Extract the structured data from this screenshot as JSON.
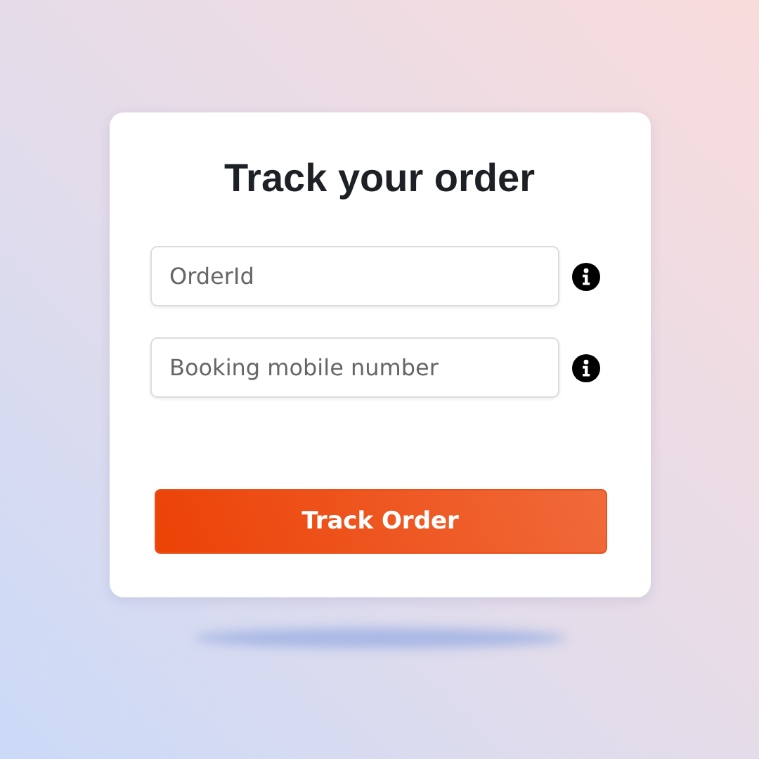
{
  "title": "Track your order",
  "fields": [
    {
      "placeholder": "OrderId"
    },
    {
      "placeholder": "Booking mobile number"
    }
  ],
  "button": "Track Order"
}
